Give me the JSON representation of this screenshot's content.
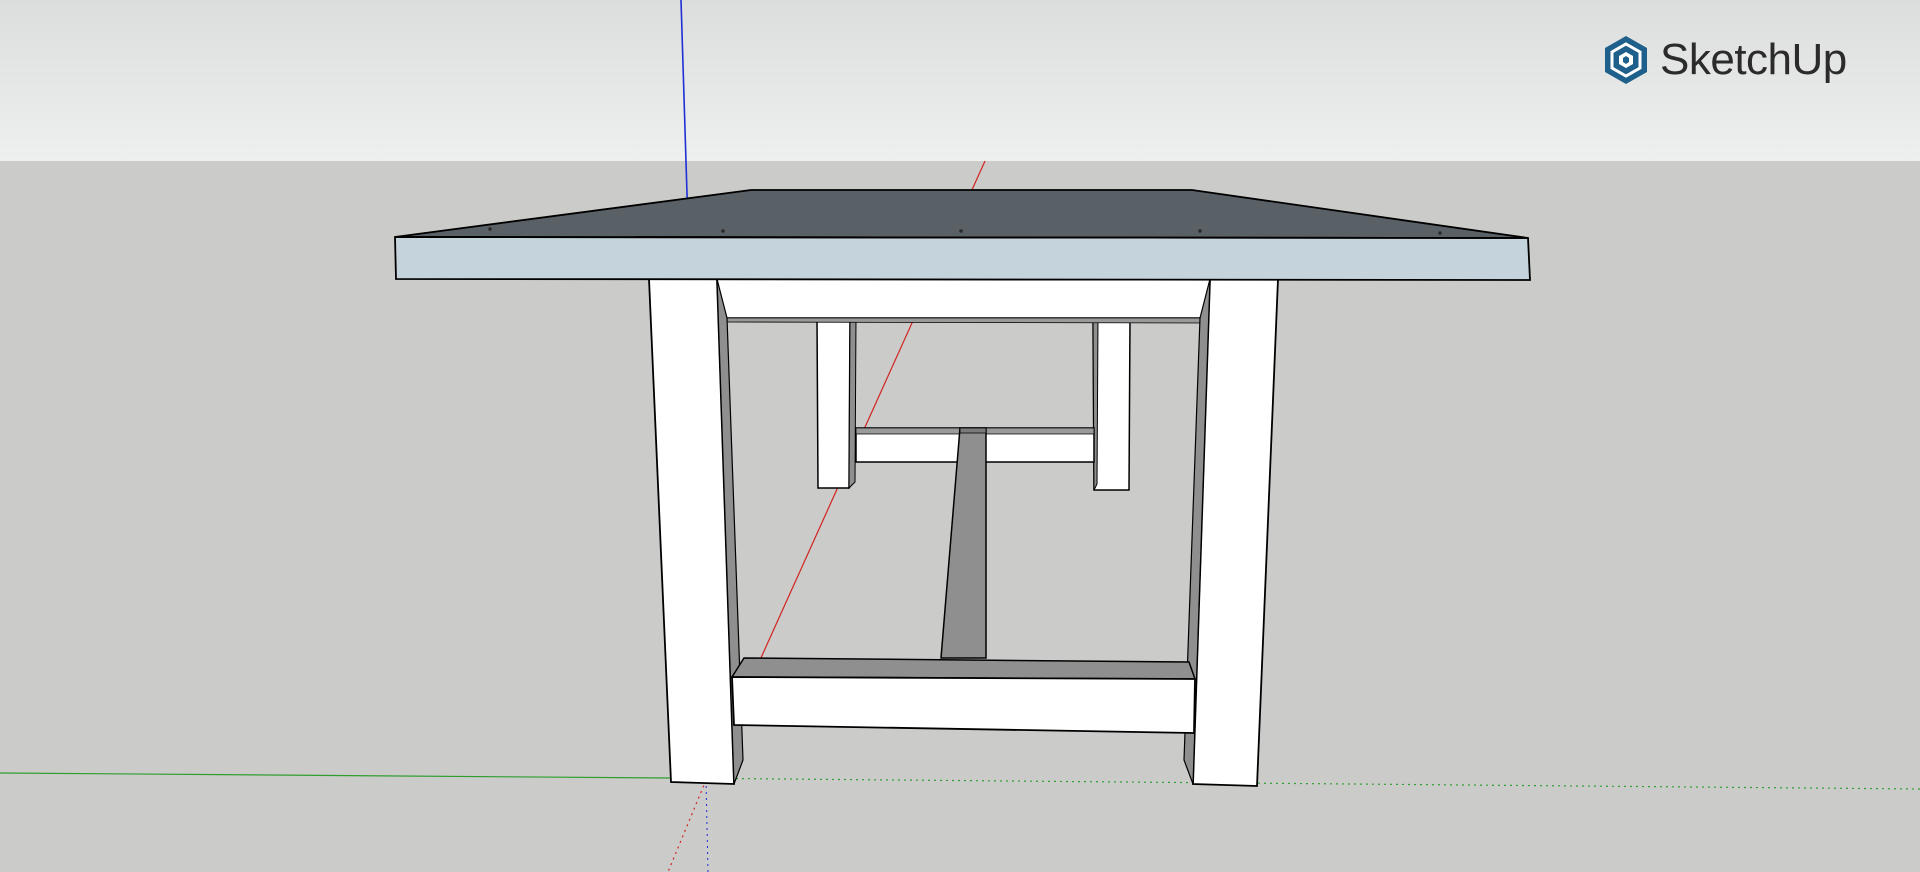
{
  "app": {
    "brand_name": "SketchUp",
    "brand_icon": "sketchup-logo-icon",
    "brand_color": "#1f5f8b"
  },
  "scene": {
    "model": "table-model",
    "style": {
      "sky_color": "#e6e7e7",
      "ground_color": "#cbcbc9",
      "tabletop_top_color": "#5a6166",
      "tabletop_edge_color": "#c4d3dc",
      "wood_face_color": "#ffffff",
      "wood_shadow_color": "#8f8f8f",
      "edge_color": "#000000",
      "axis_red": "#d2231e",
      "axis_green": "#2f9e2f",
      "axis_blue": "#1f2fd6"
    }
  }
}
